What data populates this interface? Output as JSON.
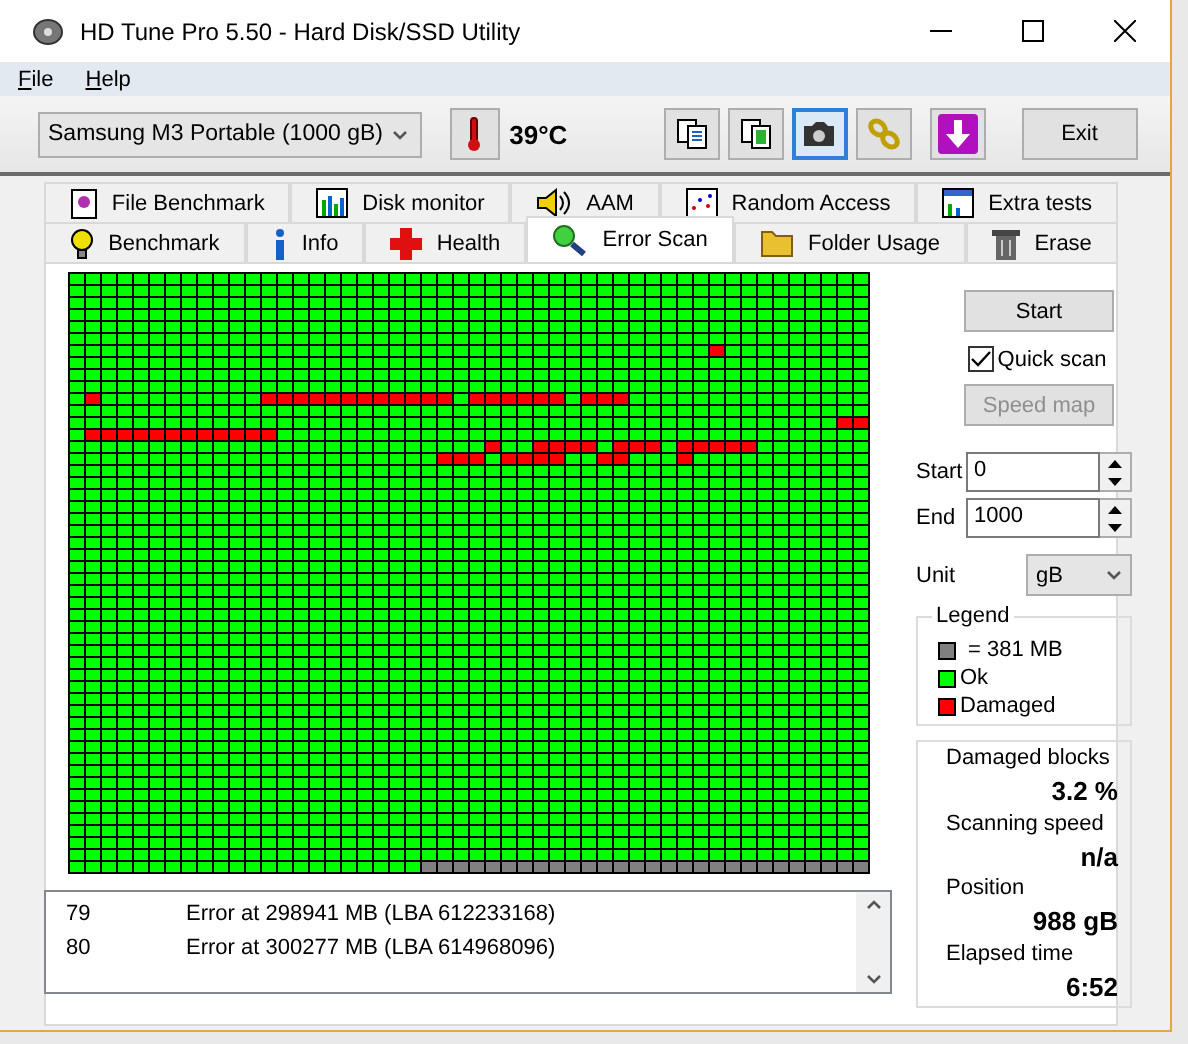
{
  "window": {
    "title": "HD Tune Pro 5.50 - Hard Disk/SSD Utility"
  },
  "menu": [
    "File",
    "Help"
  ],
  "toolbar": {
    "drive": "Samsung M3 Portable (1000 gB)",
    "temperature": "39°C",
    "buttons": [
      {
        "selected": false
      },
      {
        "selected": false
      },
      {
        "selected": true
      },
      {
        "selected": false
      },
      {
        "selected": false
      }
    ],
    "exit": "Exit"
  },
  "tabs_top": [
    {
      "label": "File Benchmark",
      "selected": false
    },
    {
      "label": "Disk monitor",
      "selected": false
    },
    {
      "label": "AAM",
      "selected": false
    },
    {
      "label": "Random Access",
      "selected": false
    },
    {
      "label": "Extra tests",
      "selected": false
    }
  ],
  "tabs_bottom": [
    {
      "label": "Benchmark",
      "selected": false
    },
    {
      "label": "Info",
      "selected": false
    },
    {
      "label": "Health",
      "selected": false
    },
    {
      "label": "Error Scan",
      "selected": true
    },
    {
      "label": "Folder Usage",
      "selected": false
    },
    {
      "label": "Erase",
      "selected": false
    }
  ],
  "log": [
    {
      "number": "79",
      "message": "Error at 298941 MB (LBA 612233168)"
    },
    {
      "number": "80",
      "message": "Error at 300277 MB (LBA 614968096)"
    }
  ],
  "controls": {
    "start_button": "Start",
    "quick_scan": {
      "label": "Quick scan",
      "checked": true
    },
    "speed_map": {
      "label": "Speed map",
      "disabled": true
    },
    "start": {
      "label": "Start",
      "value": "0"
    },
    "end": {
      "label": "End",
      "value": "1000"
    },
    "unit": {
      "label": "Unit",
      "value": "gB"
    }
  },
  "legend": {
    "title": "Legend",
    "items": [
      {
        "kind": "unscanned",
        "label": "= 381 MB",
        "color": "#808080"
      },
      {
        "kind": "ok",
        "label": "Ok",
        "color": "#00ff00"
      },
      {
        "kind": "damaged",
        "label": "Damaged",
        "color": "#ff0000"
      }
    ]
  },
  "stats": [
    {
      "label": "Damaged blocks",
      "value": "3.2 %"
    },
    {
      "label": "Scanning speed",
      "value": "n/a"
    },
    {
      "label": "Position",
      "value": "988 gB"
    },
    {
      "label": "Elapsed time",
      "value": "6:52"
    }
  ]
}
